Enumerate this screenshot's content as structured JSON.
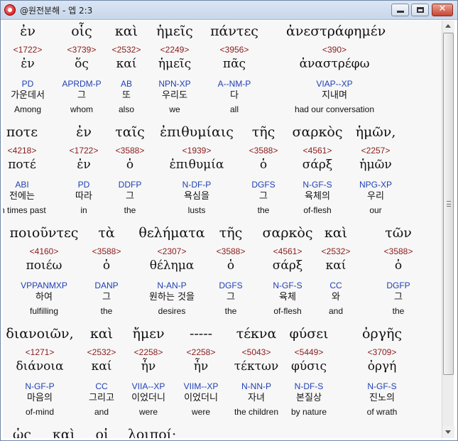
{
  "window": {
    "title": "@원전분해 - 엡 2:3",
    "minimize_label": "",
    "close_label": "✕"
  },
  "verse_lines": [
    {
      "words": [
        {
          "greek": "ἐν",
          "strong": "<1722>",
          "lemma": "ἐν",
          "morph": "PD",
          "korean": "가운데서",
          "english": "Among"
        },
        {
          "greek": "οἷς",
          "strong": "<3739>",
          "lemma": "ὅς",
          "morph": "APRDM-P",
          "korean": "그",
          "english": "whom"
        },
        {
          "greek": "καὶ",
          "strong": "<2532>",
          "lemma": "καί",
          "morph": "AB",
          "korean": "또",
          "english": "also"
        },
        {
          "greek": "ἡμεῖς",
          "strong": "<2249>",
          "lemma": "ἡμεῖς",
          "morph": "NPN-XP",
          "korean": "우리도",
          "english": "we"
        },
        {
          "greek": "πάντες",
          "strong": "<3956>",
          "lemma": "πᾶς",
          "morph": "A--NM-P",
          "korean": "다",
          "english": "all"
        },
        {
          "greek": "ἀνεστράφημέν",
          "strong": "<390>",
          "lemma": "ἀναστρέφω",
          "morph": "VIAP--XP",
          "korean": "지내며",
          "english": "had our conversation"
        }
      ]
    },
    {
      "words": [
        {
          "greek": "ποτε",
          "strong": "<4218>",
          "lemma": "ποτέ",
          "morph": "ABI",
          "korean": "전에는",
          "english": "in times past"
        },
        {
          "greek": "ἐν",
          "strong": "<1722>",
          "lemma": "ἐν",
          "morph": "PD",
          "korean": "따라",
          "english": "in"
        },
        {
          "greek": "ταῖς",
          "strong": "<3588>",
          "lemma": "ὁ",
          "morph": "DDFP",
          "korean": "그",
          "english": "the"
        },
        {
          "greek": "ἐπιθυμίαις",
          "strong": "<1939>",
          "lemma": "ἐπιθυμία",
          "morph": "N-DF-P",
          "korean": "욕심을",
          "english": "lusts"
        },
        {
          "greek": "τῆς",
          "strong": "<3588>",
          "lemma": "ὁ",
          "morph": "DGFS",
          "korean": "그",
          "english": "the"
        },
        {
          "greek": "σαρκὸς",
          "strong": "<4561>",
          "lemma": "σάρξ",
          "morph": "N-GF-S",
          "korean": "육체의",
          "english": "of-flesh"
        },
        {
          "greek": "ἡμῶν,",
          "strong": "<2257>",
          "lemma": "ἡμῶν",
          "morph": "NPG-XP",
          "korean": "우리",
          "english": "our"
        }
      ]
    },
    {
      "words": [
        {
          "greek": "ποιοῦντες",
          "strong": "<4160>",
          "lemma": "ποιέω",
          "morph": "VPPANMXP",
          "korean": "하여",
          "english": "fulfilling"
        },
        {
          "greek": "τὰ",
          "strong": "<3588>",
          "lemma": "ὁ",
          "morph": "DANP",
          "korean": "그",
          "english": "the"
        },
        {
          "greek": "θελήματα",
          "strong": "<2307>",
          "lemma": "θέλημα",
          "morph": "N-AN-P",
          "korean": "원하는 것을",
          "english": "desires"
        },
        {
          "greek": "τῆς",
          "strong": "<3588>",
          "lemma": "ὁ",
          "morph": "DGFS",
          "korean": "그",
          "english": "the"
        },
        {
          "greek": "σαρκὸς",
          "strong": "<4561>",
          "lemma": "σάρξ",
          "morph": "N-GF-S",
          "korean": "육체",
          "english": "of-flesh"
        },
        {
          "greek": "καὶ",
          "strong": "<2532>",
          "lemma": "καί",
          "morph": "CC",
          "korean": "와",
          "english": "and"
        },
        {
          "greek": "τῶν",
          "strong": "<3588>",
          "lemma": "ὁ",
          "morph": "DGFP",
          "korean": "그",
          "english": "the"
        }
      ]
    },
    {
      "words": [
        {
          "greek": "διανοιῶν,",
          "strong": "<1271>",
          "lemma": "διάνοια",
          "morph": "N-GF-P",
          "korean": "마음의",
          "english": "of-mind"
        },
        {
          "greek": "καὶ",
          "strong": "<2532>",
          "lemma": "καί",
          "morph": "CC",
          "korean": "그리고",
          "english": "and"
        },
        {
          "greek": "ἤμεν",
          "strong": "<2258>",
          "lemma": "ἦν",
          "morph": "VIIA--XP",
          "korean": "이었더니",
          "english": "were"
        },
        {
          "greek": "-----",
          "strong": "<2258>",
          "lemma": "ἦν",
          "morph": "VIIM--XP",
          "korean": "이었더니",
          "english": "were"
        },
        {
          "greek": "τέκνα",
          "strong": "<5043>",
          "lemma": "τέκτων",
          "morph": "N-NN-P",
          "korean": "자녀",
          "english": "the children"
        },
        {
          "greek": "φύσει",
          "strong": "<5449>",
          "lemma": "φύσις",
          "morph": "N-DF-S",
          "korean": "본질상",
          "english": "by nature"
        },
        {
          "greek": "ὀργῆς",
          "strong": "<3709>",
          "lemma": "ὀργή",
          "morph": "N-GF-S",
          "korean": "진노의",
          "english": "of wrath"
        }
      ]
    },
    {
      "words": [
        {
          "greek": "ὡς",
          "strong": "",
          "lemma": "",
          "morph": "",
          "korean": "",
          "english": ""
        },
        {
          "greek": "καὶ",
          "strong": "",
          "lemma": "",
          "morph": "",
          "korean": "",
          "english": ""
        },
        {
          "greek": "οἱ",
          "strong": "",
          "lemma": "",
          "morph": "",
          "korean": "",
          "english": ""
        },
        {
          "greek": "λοιποί·",
          "strong": "",
          "lemma": "",
          "morph": "",
          "korean": "",
          "english": ""
        }
      ]
    }
  ]
}
